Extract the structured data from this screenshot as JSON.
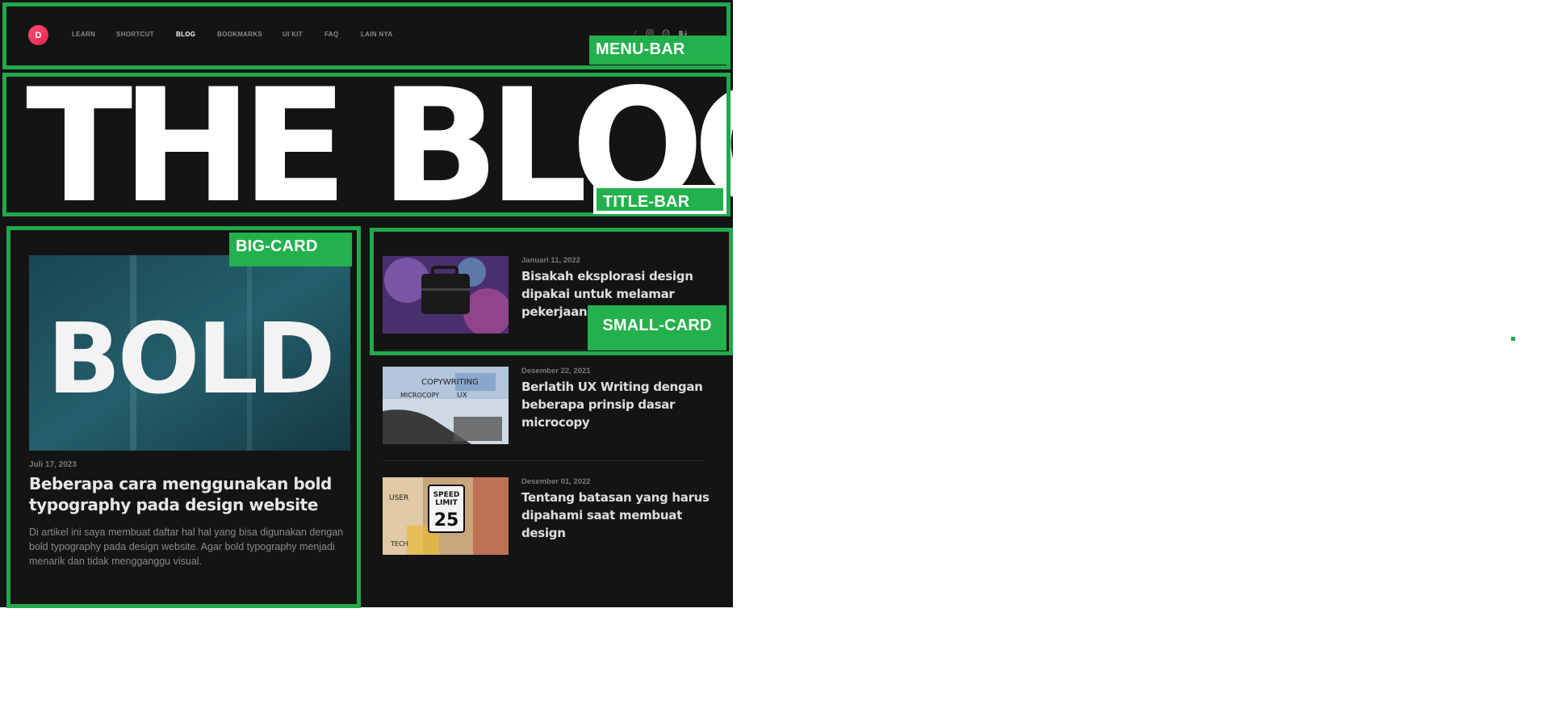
{
  "menu": {
    "logo_letter": "D",
    "items": [
      {
        "label": "LEARN",
        "active": false
      },
      {
        "label": "SHORTCUT",
        "active": false
      },
      {
        "label": "BLOG",
        "active": true
      },
      {
        "label": "BOOKMARKS",
        "active": false
      },
      {
        "label": "UI KIT",
        "active": false
      },
      {
        "label": "FAQ",
        "active": false
      },
      {
        "label": "LAIN NYA",
        "active": false
      }
    ],
    "social_icons": [
      "twitter-icon",
      "instagram-icon",
      "dribbble-icon",
      "behance-icon"
    ]
  },
  "title": {
    "text": "THE BLOG"
  },
  "big_card": {
    "image_text": "BOLD",
    "date": "Juli 17, 2023",
    "title": "Beberapa cara menggunakan bold typography pada design website",
    "description": "Di artikel ini saya membuat daftar hal hal yang bisa digunakan dengan bold typography pada design website. Agar bold typography menjadi menarik dan tidak mengganggu visual."
  },
  "posts": [
    {
      "date": "Januari 11, 2022",
      "title": "Bisakah eksplorasi design dipakai untuk melamar pekerjaan"
    },
    {
      "date": "Desember 22, 2021",
      "title": "Berlatih UX Writing dengan beberapa prinsip dasar microcopy",
      "image_text": [
        "COPYWRITING",
        "MICROCOPY",
        "UX"
      ]
    },
    {
      "date": "Desember 01, 2022",
      "title": "Tentang batasan yang harus dipahami saat membuat design",
      "image_text": [
        "SPEED",
        "LIMIT",
        "25",
        "USER",
        "TECH"
      ]
    }
  ],
  "annotations": {
    "menu_bar": "MENU-BAR",
    "title_bar": "TITLE-BAR",
    "big_card": "BIG-CARD",
    "small_card": "SMALL-CARD"
  },
  "colors": {
    "background": "#141414",
    "annotation": "#22b14c",
    "logo": "#ff4f7a"
  }
}
